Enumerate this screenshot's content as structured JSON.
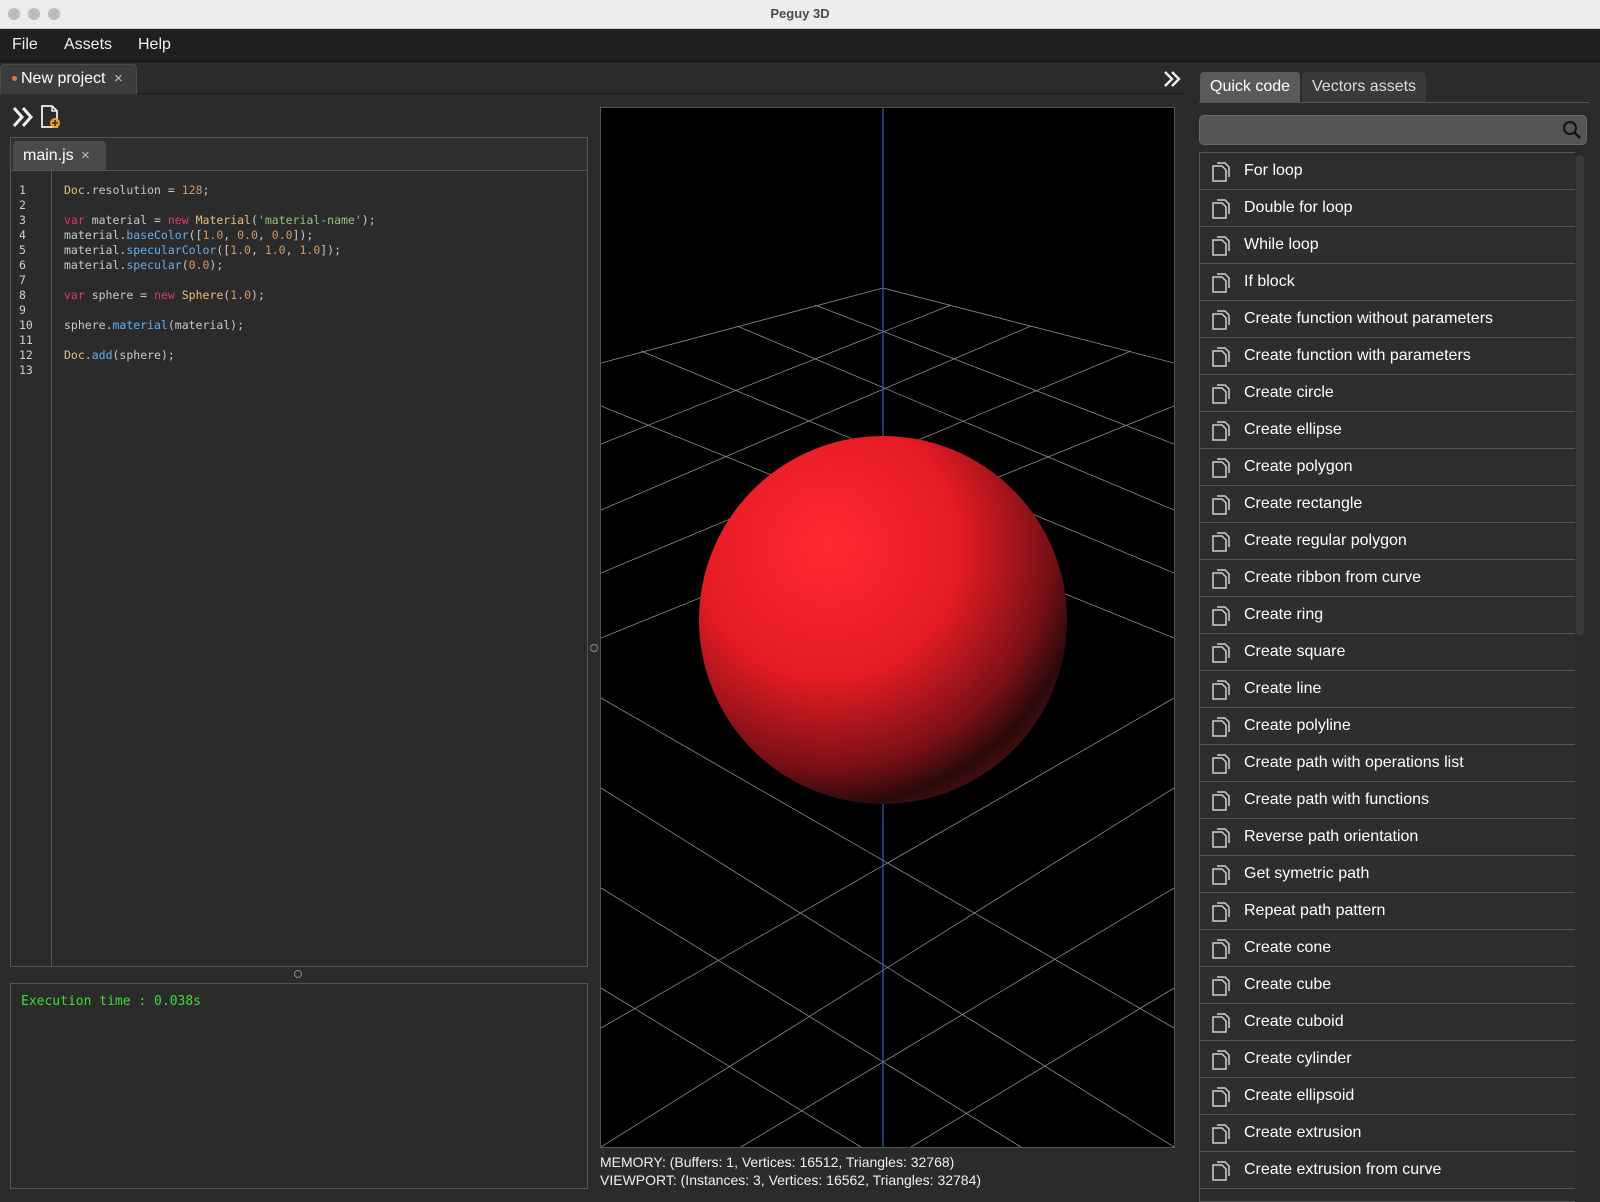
{
  "window": {
    "title": "Peguy 3D"
  },
  "menu": {
    "file": "File",
    "assets": "Assets",
    "help": "Help"
  },
  "project_tab": {
    "label": "New project",
    "close": "×"
  },
  "editor": {
    "file_tab": {
      "label": "main.js",
      "close": "×"
    },
    "line_numbers": [
      "1",
      "2",
      "3",
      "4",
      "5",
      "6",
      "7",
      "8",
      "9",
      "10",
      "11",
      "12",
      "13"
    ]
  },
  "console": {
    "text": "Execution time : 0.038s"
  },
  "viewport": {
    "memory": "MEMORY: (Buffers: 1, Vertices: 16512, Triangles: 32768)",
    "stats": "VIEWPORT: (Instances: 3, Vertices: 16562, Triangles: 32784)"
  },
  "right_panel": {
    "tabs": [
      "Quick code",
      "Vectors assets"
    ],
    "search": {
      "placeholder": ""
    },
    "items": [
      "For loop",
      "Double for loop",
      "While loop",
      "If block",
      "Create function without parameters",
      "Create function with parameters",
      "Create circle",
      "Create ellipse",
      "Create polygon",
      "Create rectangle",
      "Create regular polygon",
      "Create ribbon from curve",
      "Create ring",
      "Create square",
      "Create line",
      "Create polyline",
      "Create path with operations list",
      "Create path with functions",
      "Reverse path orientation",
      "Get symetric path",
      "Repeat path pattern",
      "Create cone",
      "Create cube",
      "Create cuboid",
      "Create cylinder",
      "Create ellipsoid",
      "Create extrusion",
      "Create extrusion from curve"
    ]
  },
  "colors": {
    "accent_tab": "#5a5a5a",
    "sphere": "#ff1f2a",
    "console_text": "#3ddc3d",
    "axis": "#3a6fd8"
  },
  "code": {
    "l1": [
      "Doc",
      ".resolution = ",
      "128",
      ";"
    ],
    "l3": [
      "var",
      " material = ",
      "new",
      " ",
      "Material",
      "(",
      "'material-name'",
      ");"
    ],
    "l4": [
      "material.",
      "baseColor",
      "([",
      "1.0",
      ", ",
      "0.0",
      ", ",
      "0.0",
      "]);"
    ],
    "l5": [
      "material.",
      "specularColor",
      "([",
      "1.0",
      ", ",
      "1.0",
      ", ",
      "1.0",
      "]);"
    ],
    "l6": [
      "material.",
      "specular",
      "(",
      "0.0",
      ");"
    ],
    "l8": [
      "var",
      " sphere = ",
      "new",
      " ",
      "Sphere",
      "(",
      "1.0",
      ");"
    ],
    "l10": [
      "sphere.",
      "material",
      "(material);"
    ],
    "l12": [
      "Doc",
      ".",
      "add",
      "(sphere);"
    ]
  }
}
